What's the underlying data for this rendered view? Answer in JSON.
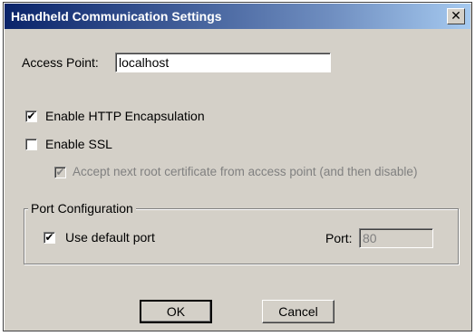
{
  "window": {
    "title": "Handheld Communication Settings",
    "close_glyph": "✕"
  },
  "access_point": {
    "label": "Access Point:",
    "value": "localhost"
  },
  "options": {
    "http": {
      "label": "Enable HTTP Encapsulation",
      "checked": true,
      "mark": "✔"
    },
    "ssl": {
      "label": "Enable SSL",
      "checked": false,
      "mark": ""
    },
    "root_cert": {
      "label": "Accept next root certificate from access point (and then disable)",
      "checked": true,
      "disabled": true,
      "mark": "✔"
    }
  },
  "port_config": {
    "legend": "Port Configuration",
    "default_port": {
      "label": "Use default port",
      "checked": true,
      "mark": "✔"
    },
    "port_label": "Port:",
    "port_value": "80"
  },
  "buttons": {
    "ok": "OK",
    "cancel": "Cancel"
  },
  "colors": {
    "title_gradient_start": "#0a246a",
    "title_gradient_end": "#a6caf0",
    "dialog_face": "#d4d0c8"
  },
  "icons": {
    "close": "close-icon",
    "check": "check-icon"
  }
}
